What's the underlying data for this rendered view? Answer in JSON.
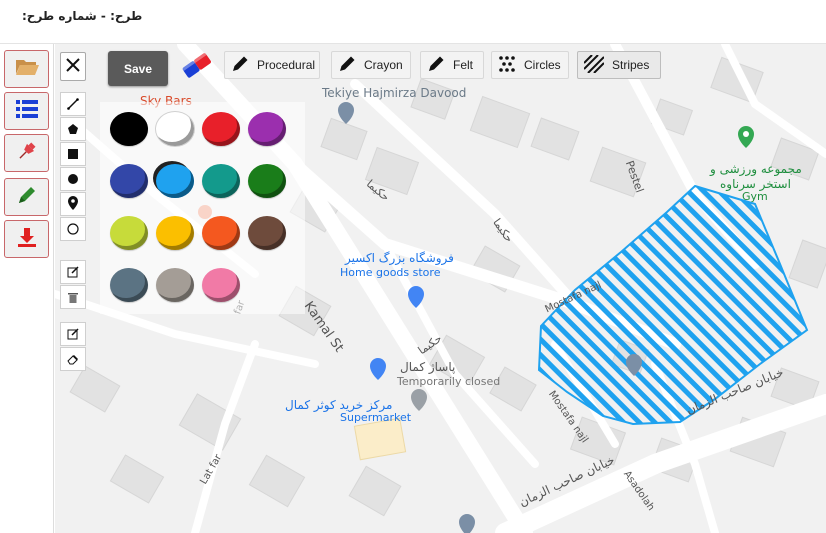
{
  "header": {
    "title": "طرح:  -  شماره طرح:"
  },
  "sidebar": {
    "items": [
      {
        "name": "folder-open-icon",
        "color": "#d9a65e"
      },
      {
        "name": "list-icon",
        "color": "#1a3fd6"
      },
      {
        "name": "pin-icon",
        "color": "#e0434a"
      },
      {
        "name": "pencil-icon",
        "color": "#2e8b2e"
      },
      {
        "name": "download-icon",
        "color": "#e02020"
      }
    ]
  },
  "toolbar": {
    "save_label": "Save",
    "brushes": [
      {
        "label": "Procedural",
        "icon": "pencil-icon"
      },
      {
        "label": "Crayon",
        "icon": "pencil-icon"
      },
      {
        "label": "Felt",
        "icon": "pencil-icon"
      },
      {
        "label": "Circles",
        "icon": "dots-icon"
      },
      {
        "label": "Stripes",
        "icon": "stripes-icon"
      }
    ]
  },
  "tools": [
    {
      "name": "close-icon"
    },
    {
      "name": "line-icon"
    },
    {
      "name": "polygon-icon"
    },
    {
      "name": "rectangle-icon"
    },
    {
      "name": "circle-filled-icon"
    },
    {
      "name": "marker-icon"
    },
    {
      "name": "circle-outline-icon"
    },
    {
      "name": "edit-icon"
    },
    {
      "name": "trash-icon"
    },
    {
      "name": "edit-icon"
    },
    {
      "name": "eraser-icon"
    }
  ],
  "palette": {
    "colors": [
      "#000000",
      "#ffffff",
      "#e8202a",
      "#9b2fae",
      "#3347a8",
      "#1fa2ef",
      "#139a8c",
      "#1a7d1a",
      "#c7db3a",
      "#fbbf00",
      "#f4581f",
      "#6e4b3c",
      "#5b7383",
      "#a49d96",
      "#f17aa6"
    ],
    "selected": "#1fa2ef"
  },
  "map": {
    "labels": {
      "sky_bars": "Sky Bars",
      "tekiye": "Tekiye Hajmirza Davood",
      "pestel": "Pestel",
      "gym_fa1": "مجموعه ورزشی و",
      "gym_fa2": "استخر سرناوه",
      "gym_en": "Gym",
      "hakima1": "حکیما",
      "hakima2": "حکیما",
      "hakima3": "حکیما",
      "store_fa": "فروشگاه بزرگ اکسیر",
      "store_en": "Home goods store",
      "kamal_st": "Kamal St",
      "mostafa1": "Mostafa najl",
      "mostafa2": "Mostafa najl",
      "pasaj_fa": "پاساژ کمال",
      "pasaj_status": "Temporarily closed",
      "markaz_fa": "مرکز خرید کوثر کمال",
      "markaz_en": "Supermarket",
      "khiaban1": "خیابان صاحب الزمان",
      "khiaban2": "خیابان صاحب الزمان",
      "latfar1": "Lat far",
      "latfar2": "Lat far",
      "asadolah": "Asadolah",
      "far": "far"
    },
    "drawing": {
      "style": "Stripes",
      "color": "#1fa2ef"
    }
  }
}
